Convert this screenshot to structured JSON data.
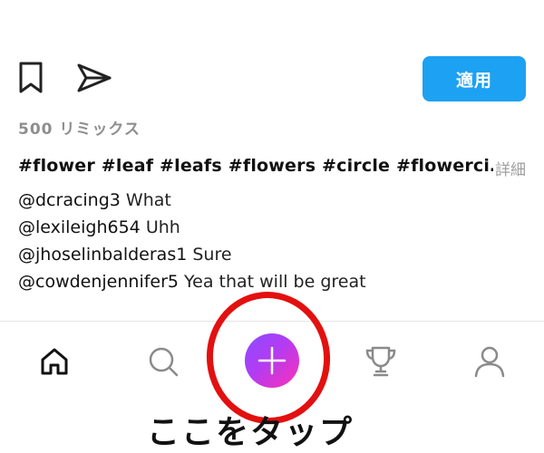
{
  "colors": {
    "accent": "#1da1f2",
    "ring": "#e31010",
    "muted": "#8e8e8e"
  },
  "actions": {
    "bookmark_icon": "bookmark-icon",
    "send_icon": "send-icon",
    "apply_label": "適用"
  },
  "remix_count": "500 リミックス",
  "hashtags": "#flower #leaf #leafs #flowers #circle #flowerci…",
  "more_label": "詳細",
  "comments": [
    {
      "user": "@dcracing3",
      "text": " What"
    },
    {
      "user": "@lexileigh654",
      "text": " Uhh"
    },
    {
      "user": "@jhoselinbalderas1",
      "text": " Sure"
    },
    {
      "user": "@cowdenjennifer5",
      "text": " Yea that will be great"
    }
  ],
  "bottom_nav": {
    "items": [
      "home-icon",
      "search-icon",
      "plus-icon",
      "trophy-icon",
      "profile-icon"
    ]
  },
  "annotation": {
    "caption": "ここをタップ"
  }
}
